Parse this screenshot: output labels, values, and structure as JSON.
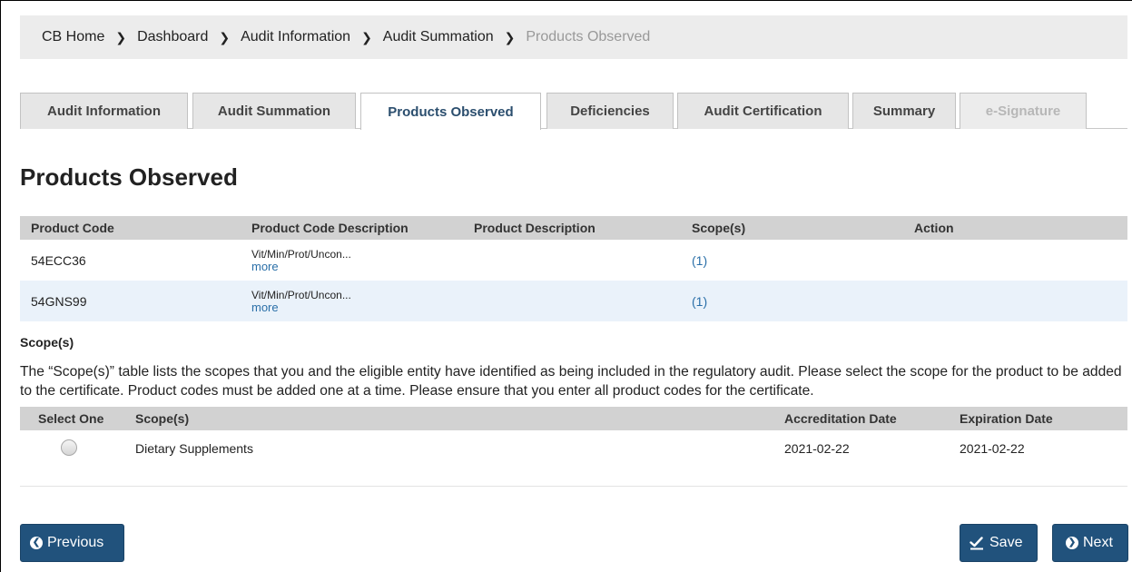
{
  "breadcrumb": [
    {
      "label": "CB Home"
    },
    {
      "label": "Dashboard"
    },
    {
      "label": "Audit Information"
    },
    {
      "label": "Audit Summation"
    },
    {
      "label": "Products Observed"
    }
  ],
  "tabs": [
    {
      "label": "Audit Information",
      "state": "inactive"
    },
    {
      "label": "Audit Summation",
      "state": "inactive"
    },
    {
      "label": "Products Observed",
      "state": "active"
    },
    {
      "label": "Deficiencies",
      "state": "inactive"
    },
    {
      "label": "Audit Certification",
      "state": "inactive"
    },
    {
      "label": "Summary",
      "state": "inactive"
    },
    {
      "label": "e-Signature",
      "state": "disabled"
    }
  ],
  "page_title": "Products Observed",
  "products_table": {
    "headers": [
      "Product Code",
      "Product Code Description",
      "Product Description",
      "Scope(s)",
      "Action"
    ],
    "rows": [
      {
        "code": "54ECC36",
        "code_description": "Vit/Min/Prot/Uncon...",
        "more": "more",
        "product_description": "",
        "scopes": "(1)",
        "action": ""
      },
      {
        "code": "54GNS99",
        "code_description": "Vit/Min/Prot/Uncon...",
        "more": "more",
        "product_description": "",
        "scopes": "(1)",
        "action": ""
      }
    ]
  },
  "scopes_section": {
    "heading": "Scope(s)",
    "description": "The “Scope(s)” table lists the scopes that you and the eligible entity have identified as being included in the regulatory audit. Please select the scope for the product to be added to the certificate. Product codes must be added one at a time. Please ensure that you enter all product codes for the certificate.",
    "headers": [
      "Select One",
      "Scope(s)",
      "Accreditation Date",
      "Expiration Date"
    ],
    "rows": [
      {
        "scope": "Dietary Supplements",
        "accreditation_date": "2021-02-22",
        "expiration_date": "2021-02-22"
      }
    ]
  },
  "buttons": {
    "previous": "Previous",
    "save": "Save",
    "next": "Next"
  },
  "colors": {
    "primary_button": "#21527c",
    "link": "#2a6fa8",
    "active_tab_text": "#2b4e6e",
    "header_bg": "#d2d2d2",
    "alt_row_bg": "#eaf2fa"
  },
  "icons": {
    "previous": "chevron-left-circle-icon",
    "save": "check-underline-icon",
    "next": "chevron-right-circle-icon",
    "separator": "chevron-right-icon"
  }
}
